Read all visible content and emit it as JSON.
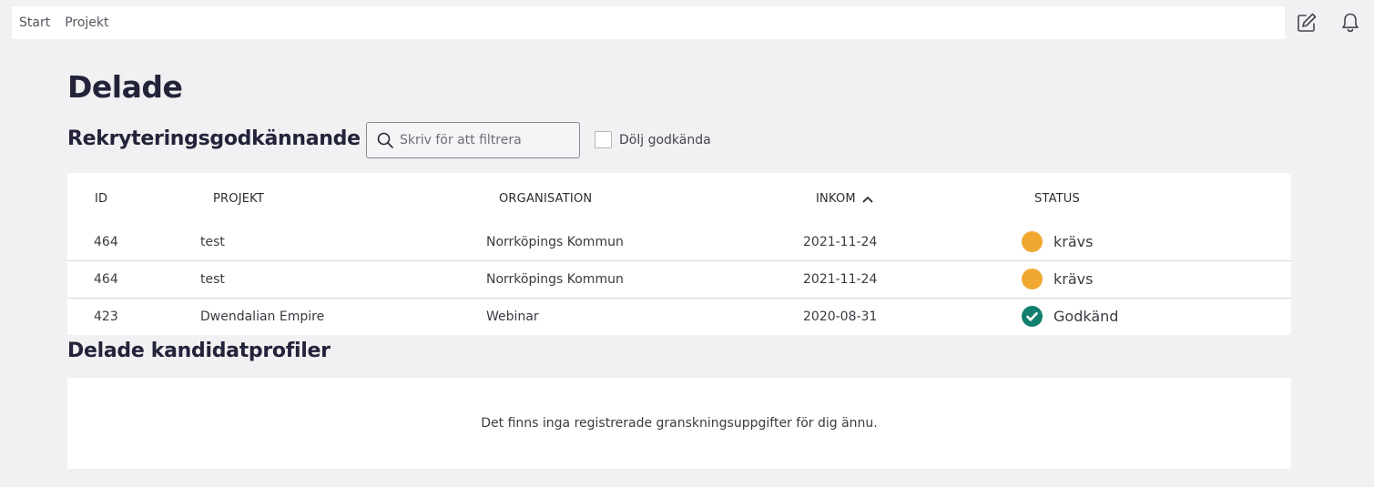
{
  "breadcrumb": [
    "Start",
    "Projekt"
  ],
  "icons": {
    "edit": "edit-note-icon",
    "notifications": "bell-icon"
  },
  "page": {
    "title": "Delade"
  },
  "recruitment": {
    "title": "Rekryteringsgodkännande",
    "search": {
      "placeholder": "Skriv för att filtrera",
      "value": ""
    },
    "hide_approved": {
      "label": "Dölj godkända",
      "checked": false
    },
    "columns": [
      "ID",
      "PROJEKT",
      "ORGANISATION",
      "INKOM",
      "STATUS"
    ],
    "sorted_column": "INKOM",
    "sort_direction": "ascending",
    "rows": [
      {
        "id": "464",
        "project": "test",
        "organisation": "Norrköpings Kommun",
        "received": "2021-11-24",
        "status": "krävs",
        "status_color": "#f0a832",
        "status_icon": "circle-icon"
      },
      {
        "id": "464",
        "project": "test",
        "organisation": "Norrköpings Kommun",
        "received": "2021-11-24",
        "status": "krävs",
        "status_color": "#f0a832",
        "status_icon": "circle-icon"
      },
      {
        "id": "423",
        "project": "Dwendalian Empire",
        "organisation": "Webinar",
        "received": "2020-08-31",
        "status": "Godkänd",
        "status_color": "#127f6e",
        "status_icon": "check-icon"
      }
    ]
  },
  "candidates": {
    "title": "Delade kandidatprofiler",
    "empty_message": "Det finns inga registrerade granskningsuppgifter för dig ännu."
  },
  "colors": {
    "background": "#f1f1f3",
    "card": "#ffffff",
    "heading": "#23233a",
    "pending": "#f0a832",
    "approved": "#127f6e"
  }
}
